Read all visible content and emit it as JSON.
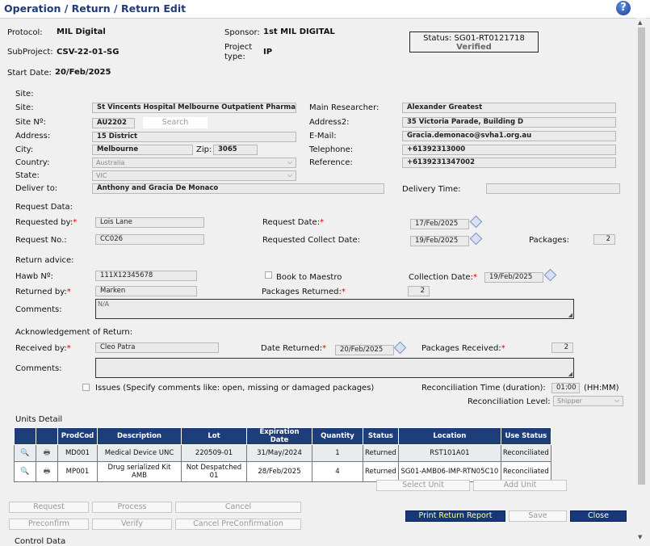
{
  "window": {
    "title": "Operation / Return / Return Edit",
    "help_glyph": "?"
  },
  "header": {
    "protocol_label": "Protocol:",
    "protocol": "MIL Digital",
    "subproject_label": "SubProject:",
    "subproject": "CSV-22-01-SG",
    "start_date_label": "Start Date:",
    "start_date": "20/Feb/2025",
    "sponsor_label": "Sponsor:",
    "sponsor": "1st MIL DIGITAL",
    "project_type_label_1": "Project",
    "project_type_label_2": "type:",
    "project_type": "IP",
    "status": "Status: SG01-RT0121718",
    "status_sub": "Verified"
  },
  "site": {
    "section": "Site:",
    "site_label": "Site:",
    "site": "St Vincents Hospital Melbourne Outpatient Pharmacy",
    "site_no_label": "Site Nº:",
    "site_no": "AU2202",
    "search_label": "Search",
    "address_label": "Address:",
    "address": "15 District",
    "city_label": "City:",
    "city": "Melbourne",
    "zip_label": "Zip:",
    "zip": "3065",
    "country_label": "Country:",
    "country": "Australia",
    "state_label": "State:",
    "state": "VIC",
    "deliver_label": "Deliver to:",
    "deliver_to": "Anthony and Gracia De Monaco",
    "main_researcher_label": "Main Researcher:",
    "main_researcher": "Alexander Greatest",
    "address2_label": "Address2:",
    "address2": "35 Victoria Parade, Building D",
    "email_label": "E-Mail:",
    "email": "Gracia.demonaco@svha1.org.au",
    "telephone_label": "Telephone:",
    "telephone": "+61392313000",
    "reference_label": "Reference:",
    "reference": "+6139231347002",
    "delivery_time_label": "Delivery Time:",
    "delivery_time": ""
  },
  "request": {
    "section": "Request Data:",
    "requested_by_label": "Requested by:",
    "requested_by": "Lois Lane",
    "request_no_label": "Request No.:",
    "request_no": "CC026",
    "request_date_label": "Request Date:",
    "request_date": "17/Feb/2025",
    "collect_date_label": "Requested Collect Date:",
    "collect_date": "19/Feb/2025",
    "packages_label": "Packages:",
    "packages": "2"
  },
  "return_advice": {
    "section": "Return advice:",
    "hawb_label": "Hawb Nº:",
    "hawb": "111X12345678",
    "book_label": "Book to Maestro",
    "collection_date_label": "Collection Date:",
    "collection_date": "19/Feb/2025",
    "returned_by_label": "Returned by:",
    "returned_by": "Marken",
    "packages_returned_label": "Packages Returned:",
    "packages_returned": "2",
    "comments_label": "Comments:",
    "comments": "N/A"
  },
  "acknowledgement": {
    "section": "Acknowledgement of Return:",
    "received_by_label": "Received by:",
    "received_by": "Cleo Patra",
    "date_returned_label": "Date Returned:",
    "date_returned": "20/Feb/2025",
    "packages_received_label": "Packages Received:",
    "packages_received": "2",
    "comments_label": "Comments:",
    "comments": "",
    "issues_label": "Issues (Specify comments like: open, missing or damaged packages)",
    "recon_time_label": "Reconciliation Time (duration):",
    "recon_time": "01:00",
    "recon_time_unit": "(HH:MM)",
    "recon_level_label": "Reconciliation Level:",
    "recon_level": "Shipper"
  },
  "units": {
    "section": "Units Detail",
    "columns": [
      "",
      "",
      "ProdCod",
      "Description",
      "Lot",
      "Expiration Date",
      "Quantity",
      "Status",
      "Location",
      "Use Status"
    ],
    "rows": [
      [
        "MD001",
        "Medical Device UNC",
        "220509-01",
        "31/May/2024",
        "1",
        "Returned",
        "RST101A01",
        "Reconciliated"
      ],
      [
        "MP001",
        "Drug serialized Kit AMB",
        "Not Despatched 01",
        "28/Feb/2025",
        "4",
        "Returned",
        "SG01-AMB06-IMP-RTN05C10",
        "Reconciliated"
      ]
    ],
    "select_unit": "Select Unit",
    "add_unit": "Add Unit"
  },
  "actions": {
    "request": "Request",
    "process": "Process",
    "cancel": "Cancel",
    "preconfirm": "Preconfirm",
    "verify": "Verify",
    "cancel_preconfirmation": "Cancel PreConfirmation",
    "print": "Print Return Report",
    "save": "Save",
    "close": "Close"
  },
  "footer": {
    "control_data": "Control Data"
  }
}
